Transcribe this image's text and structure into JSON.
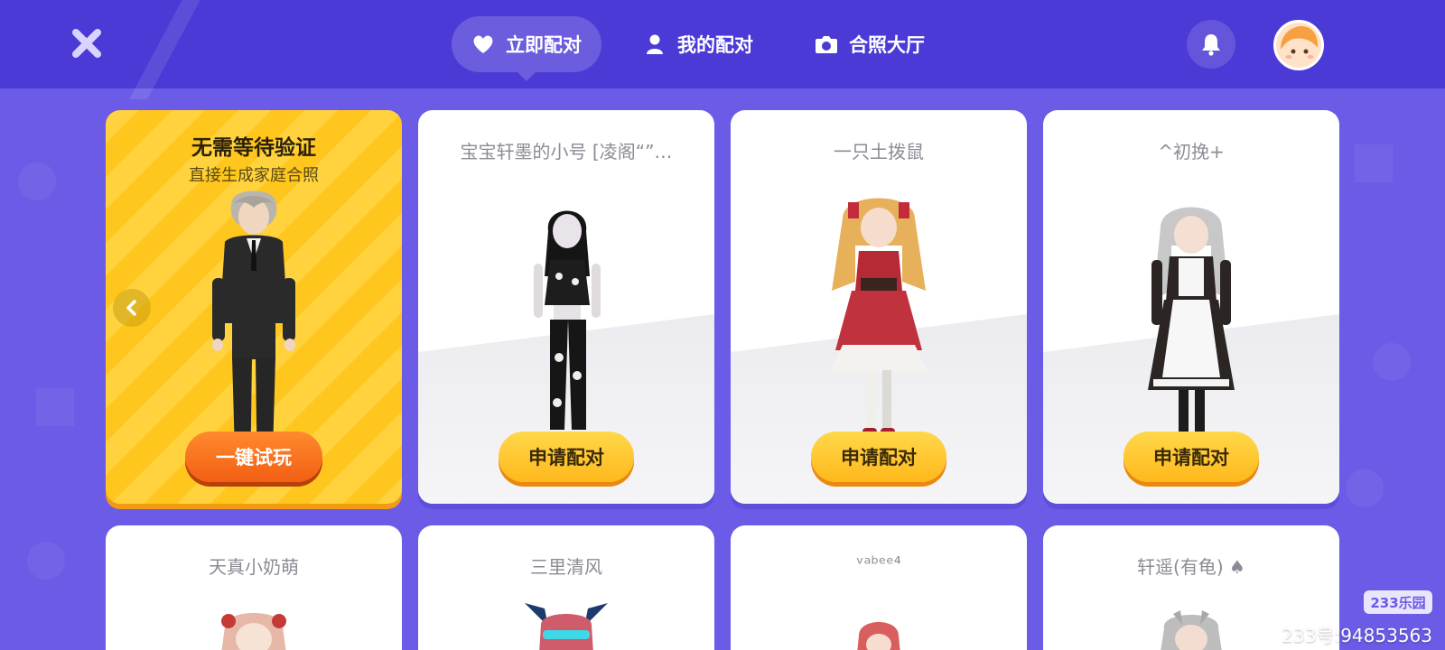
{
  "nav": {
    "tabs": [
      {
        "label": "立即配对",
        "icon": "heart-icon",
        "active": true
      },
      {
        "label": "我的配对",
        "icon": "user-icon",
        "active": false
      },
      {
        "label": "合照大厅",
        "icon": "camera-icon",
        "active": false
      }
    ]
  },
  "featured": {
    "title": "无需等待验证",
    "subtitle": "直接生成家庭合照",
    "button_label": "一键试玩"
  },
  "cards_row1": [
    {
      "name": "宝宝轩墨的小号 [凌阁“”…",
      "button_label": "申请配对"
    },
    {
      "name": "一只土拨鼠",
      "button_label": "申请配对"
    },
    {
      "name": "^初挽+",
      "button_label": "申请配对"
    }
  ],
  "cards_row2": [
    {
      "name": "天真小奶萌"
    },
    {
      "name": "三里清风"
    },
    {
      "name": "ᵛᵃᵇᵉᵉ⁴"
    },
    {
      "name": "轩遥(有龟) ♠"
    }
  ],
  "watermark": {
    "logo_text": "233乐园",
    "id_text": "233号:94853563"
  },
  "colors": {
    "topbar": "#4b3ad6",
    "background": "#6b5be6",
    "button_yellow": "#ffc21c",
    "button_orange": "#f25f14"
  }
}
